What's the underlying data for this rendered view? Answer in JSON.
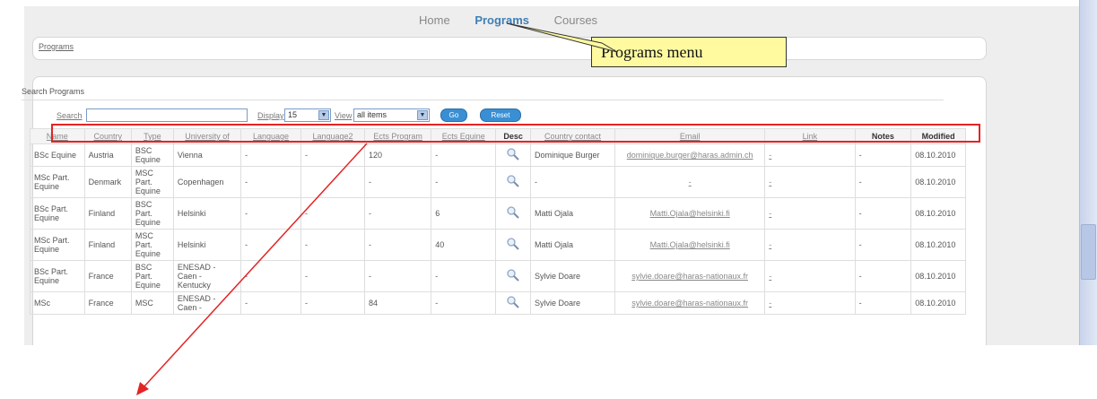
{
  "nav": {
    "items": [
      "Home",
      "Programs",
      "Courses"
    ],
    "active": "Programs"
  },
  "breadcrumb": "Programs",
  "panel_title": "Search Programs",
  "search": {
    "search_label": "Search",
    "display_label": "Display",
    "display_value": "15",
    "view_label": "View",
    "view_value": "all items",
    "go_label": "Go",
    "reset_label": "Reset"
  },
  "table": {
    "headers": [
      "Name",
      "Country",
      "Type",
      "University of",
      "Language",
      "Language2",
      "Ects Program",
      "Ects Equine",
      "Desc",
      "Country contact",
      "Email",
      "Link",
      "Notes",
      "Modified"
    ],
    "rows": [
      {
        "name": "BSc Equine",
        "country": "Austria",
        "type": "BSC Equine",
        "university": "Vienna",
        "language": "-",
        "language2": "-",
        "ects_program": "120",
        "ects_equine": "-",
        "contact": "Dominique Burger",
        "email": "dominique.burger@haras.admin.ch",
        "link": "-",
        "notes": "-",
        "modified": "08.10.2010"
      },
      {
        "name": "MSc Part. Equine",
        "country": "Denmark",
        "type": "MSC Part. Equine",
        "university": "Copenhagen",
        "language": "-",
        "language2": "",
        "ects_program": "-",
        "ects_equine": "-",
        "contact": "-",
        "email": "-",
        "link": "-",
        "notes": "-",
        "modified": "08.10.2010"
      },
      {
        "name": "BSc Part. Equine",
        "country": "Finland",
        "type": "BSC Part. Equine",
        "university": "Helsinki",
        "language": "-",
        "language2": "-",
        "ects_program": "-",
        "ects_equine": "6",
        "contact": "Matti Ojala",
        "email": "Matti.Ojala@helsinki.fi",
        "link": "-",
        "notes": "-",
        "modified": "08.10.2010"
      },
      {
        "name": "MSc Part. Equine",
        "country": "Finland",
        "type": "MSC Part. Equine",
        "university": "Helsinki",
        "language": "-",
        "language2": "-",
        "ects_program": "-",
        "ects_equine": "40",
        "contact": "Matti Ojala",
        "email": "Matti.Ojala@helsinki.fi",
        "link": "-",
        "notes": "-",
        "modified": "08.10.2010"
      },
      {
        "name": "BSc Part. Equine",
        "country": "France",
        "type": "BSC Part. Equine",
        "university": "ENESAD - Caen - Kentucky",
        "language": "-",
        "language2": "-",
        "ects_program": "-",
        "ects_equine": "-",
        "contact": "Sylvie Doare",
        "email": "sylvie.doare@haras-nationaux.fr",
        "link": "-",
        "notes": "-",
        "modified": "08.10.2010"
      },
      {
        "name": "MSc",
        "country": "France",
        "type": "MSC",
        "university": "ENESAD - Caen -",
        "language": "-",
        "language2": "-",
        "ects_program": "84",
        "ects_equine": "-",
        "contact": "Sylvie Doare",
        "email": "sylvie.doare@haras-nationaux.fr",
        "link": "-",
        "notes": "-",
        "modified": "08.10.2010"
      }
    ]
  },
  "annotation": {
    "callout_text": "Programs menu"
  },
  "colors": {
    "highlight": "#e42424",
    "callout_bg": "#fffaa0",
    "accent": "#3a8fd4"
  }
}
